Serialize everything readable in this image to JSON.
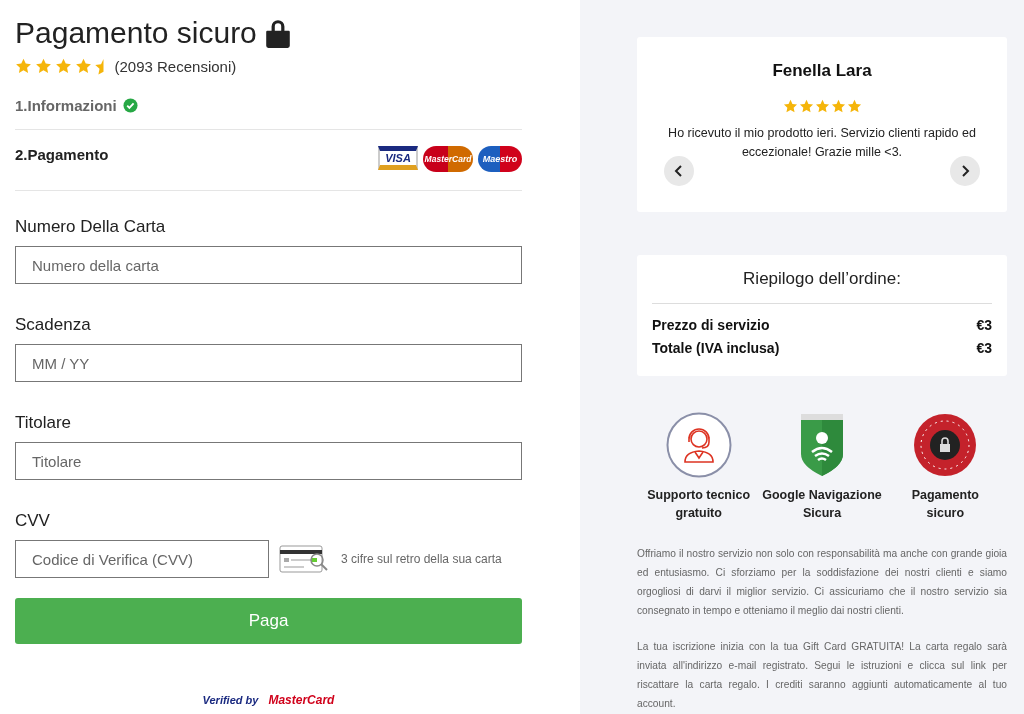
{
  "title": "Pagamento sicuro",
  "rating": {
    "stars": 4.5,
    "count": "(2093 Recensioni)"
  },
  "steps": [
    {
      "label": "1.Informazioni",
      "done": true
    },
    {
      "label": "2.Pagamento",
      "done": false
    }
  ],
  "card_logos": [
    "VISA",
    "MasterCard",
    "Maestro"
  ],
  "fields": [
    {
      "label": "Numero Della Carta",
      "placeholder": "Numero della carta"
    },
    {
      "label": "Scadenza",
      "placeholder": "MM / YY"
    },
    {
      "label": "Titolare",
      "placeholder": "Titolare"
    },
    {
      "label": "CVV",
      "placeholder": "Codice di Verifica (CVV)",
      "kind": "cvv",
      "hint": "3 cifre sul retro della sua carta"
    }
  ],
  "pay_button": "Paga",
  "bottom_badges": [
    "Verified by",
    "MasterCard"
  ],
  "review": {
    "name": "Fenella Lara",
    "stars": 5,
    "text": "Ho ricevuto il mio prodotto ieri. Servizio clienti rapido ed eccezionale! Grazie mille <3."
  },
  "summary": {
    "title": "Riepilogo dell’ordine:",
    "rows": [
      {
        "label": "Prezzo di servizio",
        "value": "€3"
      },
      {
        "label": "Totale (IVA inclusa)",
        "value": "€3"
      }
    ]
  },
  "features": [
    {
      "kind": "support",
      "label": "Supporto tecnico gratuito"
    },
    {
      "kind": "shield",
      "label": "Google Navigazione Sicura"
    },
    {
      "kind": "secure",
      "label": "Pagamento sicuro"
    }
  ],
  "paragraphs": [
    "Offriamo il nostro servizio non solo con responsabilità ma anche con grande gioia ed entusiasmo. Ci sforziamo per la soddisfazione dei nostri clienti e siamo orgogliosi di darvi il miglior servizio. Ci assicuriamo che il nostro servizio sia consegnato in tempo e otteniamo il meglio dai nostri clienti.",
    "La tua iscrizione inizia con la tua Gift Card GRATUITA! La carta regalo sarà inviata all'indirizzo e-mail registrato. Segui le istruzioni e clicca sul link per riscattare la carta regalo. I crediti saranno aggiunti automaticamente al tuo account."
  ]
}
